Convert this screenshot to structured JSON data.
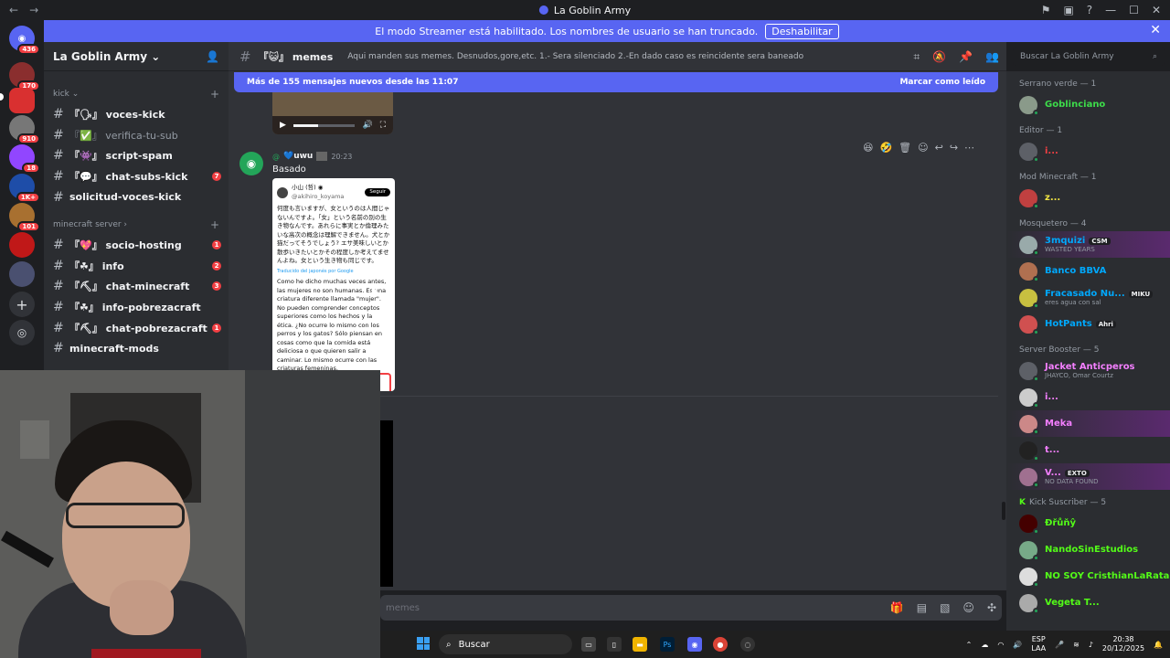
{
  "window": {
    "title": "La Goblin Army",
    "controls": [
      "—",
      "☐",
      "✕"
    ]
  },
  "banner": {
    "text": "El modo Streamer está habilitado. Los nombres de usuario se han truncado.",
    "button": "Deshabilitar"
  },
  "servers": [
    {
      "badge": "436"
    },
    {
      "badge": "170"
    },
    {
      "badge": ""
    },
    {
      "badge": "910"
    },
    {
      "badge": "18"
    },
    {
      "badge": "1K+"
    },
    {
      "badge": "101"
    },
    {
      "badge": ""
    },
    {
      "badge": ""
    }
  ],
  "server": {
    "name": "La Goblin Army"
  },
  "categories": [
    {
      "name": "kick",
      "channels": [
        {
          "name": "『🗣』 voces-kick",
          "muted": false,
          "badge": ""
        },
        {
          "name": "『✅』 verifica-tu-sub",
          "muted": true,
          "badge": ""
        },
        {
          "name": "『👾』 script-spam",
          "muted": false,
          "badge": ""
        },
        {
          "name": "『💬』 chat-subs-kick",
          "muted": false,
          "badge": "7"
        },
        {
          "name": "solicitud-voces-kick",
          "muted": false,
          "badge": ""
        }
      ]
    },
    {
      "name": "minecraft server",
      "channels": [
        {
          "name": "『💖』 socio-hosting",
          "muted": false,
          "badge": "1"
        },
        {
          "name": "『☘』 info",
          "muted": false,
          "badge": "2"
        },
        {
          "name": "『⛏』 chat-minecraft",
          "muted": false,
          "badge": "3"
        },
        {
          "name": "『☘』 info-pobrezacraft",
          "muted": false,
          "badge": ""
        },
        {
          "name": "『⛏』 chat-pobrezacraft",
          "muted": false,
          "badge": "1"
        },
        {
          "name": "minecraft-mods",
          "muted": false,
          "badge": ""
        }
      ]
    }
  ],
  "channel": {
    "name": "『😺』 memes",
    "topic": "Aqui manden sus memes. Desnudos,gore,etc. 1.- Sera silenciado 2.-En dado caso es reincidente sera baneado"
  },
  "search": {
    "placeholder": "Buscar La Goblin Army"
  },
  "new_messages": {
    "text": "Más de 155 mensajes nuevos desde las 11:07",
    "action": "Marcar como leído"
  },
  "message": {
    "user": "💙uwu",
    "time": "20:23",
    "text": "Basado"
  },
  "tweet": {
    "author": "小山 (哲) ◉",
    "handle": "@akihiro_koyama",
    "follow": "Seguir",
    "original": "何度も言いますが、女というのは人間じゃないんですよ。「女」という名前の別の生き物なんです。あれらに事実とか倫理みたいな高次の概念は理解できません。犬とか猫だってそうでしょう? エサ美味しいとか散歩いきたいとかその程度しか考えてませんよね。女という生き物も同じです。",
    "translated_by": "Traducido del japonés por Google",
    "translation": "Como he dicho muchas veces antes, las mujeres no son humanas. Es una criatura diferente llamada \"mujer\". No pueden comprender conceptos superiores como los hechos y la ética. ¿No ocurre lo mismo con los perros y los gatos? Sólo piensan en cosas como que la comida está deliciosa o que quieren salir a caminar. Lo mismo ocurre con las criaturas femeninas."
  },
  "composer": {
    "placeholder": "memes"
  },
  "member_groups": [
    {
      "role": "Serrano verde — 1",
      "members": [
        {
          "name": "Goblinciano",
          "color": "#3ddc4a",
          "sub": "",
          "tag": ""
        }
      ]
    },
    {
      "role": "Editor — 1",
      "members": [
        {
          "name": "i...",
          "color": "#f23f43",
          "sub": "",
          "tag": ""
        }
      ]
    },
    {
      "role": "Mod Minecraft — 1",
      "members": [
        {
          "name": "z...",
          "color": "#f0e442",
          "sub": "",
          "tag": ""
        }
      ]
    },
    {
      "role": "Mosquetero — 4",
      "members": [
        {
          "name": "3mquizi",
          "color": "#00a8fc",
          "sub": "WASTED YEARS",
          "tag": "CSM"
        },
        {
          "name": "Banco BBVA",
          "color": "#00a8fc",
          "sub": "",
          "tag": ""
        },
        {
          "name": "Fracasado Nu...",
          "color": "#00a8fc",
          "sub": "eres agua con sal",
          "tag": "MIKU"
        },
        {
          "name": "HotPants",
          "color": "#00a8fc",
          "sub": "",
          "tag": "Ahri"
        }
      ]
    },
    {
      "role": "Server Booster — 5",
      "members": [
        {
          "name": "Jacket Anticperos",
          "color": "#f47fff",
          "sub": "JHAYCO, Omar Courtz",
          "tag": ""
        },
        {
          "name": "i...",
          "color": "#f47fff",
          "sub": "",
          "tag": ""
        },
        {
          "name": "Meka",
          "color": "#f47fff",
          "sub": "",
          "tag": ""
        },
        {
          "name": "t...",
          "color": "#f47fff",
          "sub": "",
          "tag": ""
        },
        {
          "name": "V...",
          "color": "#f47fff",
          "sub": "NO DATA FOUND",
          "tag": "EXTO"
        }
      ]
    },
    {
      "role": "Kick Suscriber — 5",
      "members": [
        {
          "name": "Ðřůňŷ",
          "color": "#53fc18",
          "sub": "",
          "tag": ""
        },
        {
          "name": "NandoSinEstudios",
          "color": "#53fc18",
          "sub": "",
          "tag": ""
        },
        {
          "name": "NO SOY CristhianLaRata",
          "color": "#53fc18",
          "sub": "",
          "tag": ""
        },
        {
          "name": "Vegeta T...",
          "color": "#53fc18",
          "sub": "",
          "tag": ""
        }
      ]
    }
  ],
  "taskbar": {
    "search": "Buscar",
    "lang": "ESP",
    "lang2": "LAA",
    "time": "20:38",
    "date": "20/12/2025"
  }
}
